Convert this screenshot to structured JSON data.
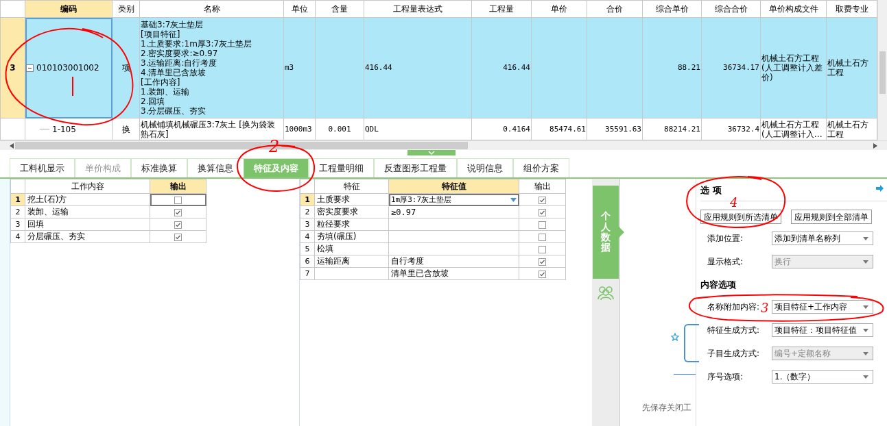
{
  "grid": {
    "columns": [
      "编码",
      "类别",
      "名称",
      "单位",
      "含量",
      "工程量表达式",
      "工程量",
      "单价",
      "合价",
      "综合单价",
      "综合合价",
      "单价构成文件",
      "取费专业"
    ],
    "rows": [
      {
        "row_number": "3",
        "selected": true,
        "expanded": true,
        "cells": [
          "010103001002",
          "项",
          "基础3:7灰土垫层\n[项目特征]\n1.土质要求:1m厚3:7灰土垫层\n2.密实度要求:≥0.97\n3.运输距离:自行考度\n4.清单里已含放坡\n[工作内容]\n1.装卸、运输\n2.回填\n3.分层碾压、夯实",
          "m3",
          null,
          "416.44",
          "416.44",
          null,
          null,
          "88.21",
          "36734.17",
          "机械土石方工程(人工调整计入差价)",
          "机械土石方工程"
        ],
        "children": [
          {
            "selected": false,
            "cells": [
              "1-105",
              "换",
              "机械铺填机械碾压3:7灰土  [换为袋装熟石灰]",
              "1000m3",
              "0.001",
              "QDL",
              "0.4164",
              "85474.61",
              "35591.63",
              "88214.21",
              "36732.4",
              "机械土石方工程(人工调整计入…",
              "机械土石方工程"
            ]
          }
        ]
      }
    ]
  },
  "tabs": [
    {
      "label": "工料机显示",
      "selected": false,
      "disabled": false
    },
    {
      "label": "单价构成",
      "selected": false,
      "disabled": true
    },
    {
      "label": "标准换算",
      "selected": false,
      "disabled": false
    },
    {
      "label": "换算信息",
      "selected": false,
      "disabled": false
    },
    {
      "label": "特征及内容",
      "selected": true,
      "disabled": false
    },
    {
      "label": "工程量明细",
      "selected": false,
      "disabled": false
    },
    {
      "label": "反查图形工程量",
      "selected": false,
      "disabled": false
    },
    {
      "label": "说明信息",
      "selected": false,
      "disabled": false
    },
    {
      "label": "组价方案",
      "selected": false,
      "disabled": false
    }
  ],
  "work_table": {
    "columns": [
      "工作内容",
      "输出"
    ],
    "rows": [
      {
        "number": "1",
        "text": "挖土(石)方",
        "checked": false,
        "selected": true
      },
      {
        "number": "2",
        "text": "装卸、运输",
        "checked": true,
        "selected": false
      },
      {
        "number": "3",
        "text": "回填",
        "checked": true,
        "selected": false
      },
      {
        "number": "4",
        "text": "分层碾压、夯实",
        "checked": true,
        "selected": false
      }
    ]
  },
  "feature_table": {
    "columns": [
      "特征",
      "特征值",
      "输出"
    ],
    "rows": [
      {
        "number": "1",
        "feature": "土质要求",
        "value": "1m厚3:7灰土垫层",
        "checked": true,
        "selected": true
      },
      {
        "number": "2",
        "feature": "密实度要求",
        "value": "≥0.97",
        "checked": true,
        "selected": false
      },
      {
        "number": "3",
        "feature": "粒径要求",
        "checked": false,
        "selected": false
      },
      {
        "number": "4",
        "feature": "夯填(碾压)",
        "checked": false,
        "selected": false
      },
      {
        "number": "5",
        "feature": "松填",
        "checked": false,
        "selected": false
      },
      {
        "number": "6",
        "feature": "运输距离",
        "value": "自行考度",
        "checked": true,
        "selected": false
      },
      {
        "number": "7",
        "value": "清单里已含放坡",
        "checked": true,
        "selected": false
      }
    ]
  },
  "side_tab": {
    "label": "个人数据"
  },
  "hidden_panel": {
    "hint": "先保存关闭工"
  },
  "options": {
    "title": "选 项",
    "buttons": [
      "应用规则到所选清单",
      "应用规则到全部清单"
    ],
    "fields": [
      {
        "label": "添加位置:",
        "value": "添加到清单名称列",
        "disabled": false
      },
      {
        "label": "显示格式:",
        "value": "换行",
        "disabled": true
      }
    ],
    "content_title": "内容选项",
    "content_fields": [
      {
        "label": "名称附加内容:",
        "value": "项目特征+工作内容",
        "disabled": false
      },
      {
        "label": "特征生成方式:",
        "value": "项目特征：项目特征值",
        "disabled": false
      },
      {
        "label": "子目生成方式:",
        "value": "编号+定额名称",
        "disabled": true
      },
      {
        "label": "序号选项:",
        "value": "1.（数字）",
        "disabled": false
      }
    ]
  },
  "annotations": [
    {
      "kind": "circle"
    },
    {
      "kind": "stroke"
    },
    {
      "kind": "circle"
    },
    {
      "kind": "number",
      "text": "2"
    },
    {
      "kind": "circle"
    },
    {
      "kind": "number",
      "text": "4"
    },
    {
      "kind": "circle"
    },
    {
      "kind": "number",
      "text": "3"
    }
  ]
}
